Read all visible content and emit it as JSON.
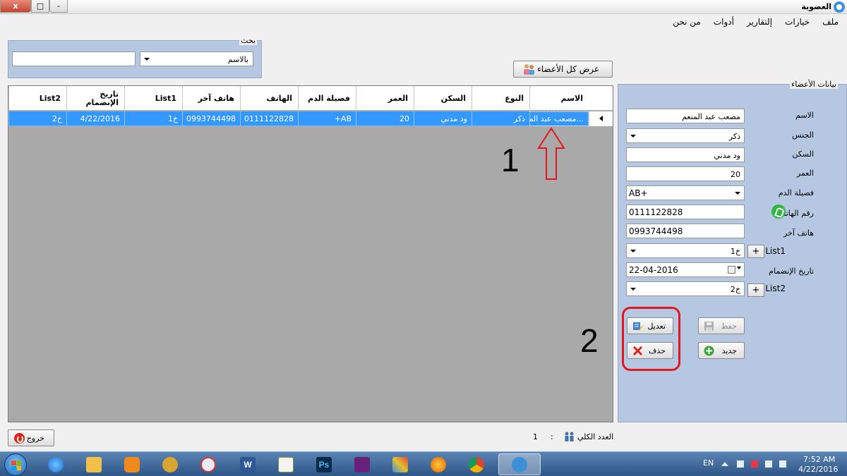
{
  "window": {
    "title": "العضوية"
  },
  "menu": [
    {
      "label": "ملف"
    },
    {
      "label": "خيارات"
    },
    {
      "label": "إلتقارير"
    },
    {
      "label": "أدوات"
    },
    {
      "label": "من نحن"
    }
  ],
  "search": {
    "legend": "بحث",
    "by_value": "بالاسم",
    "text_value": ""
  },
  "show_all_button": {
    "label": "عرض كل الأعضاء",
    "icon": "members-icon"
  },
  "grid": {
    "columns": [
      "الاسم",
      "النوع",
      "السكن",
      "العمر",
      "فصيلة الدم",
      "الهاتف",
      "هاتف آخر",
      "List1",
      "تاريخ الإنضمام",
      "List2"
    ],
    "rows": [
      [
        "مصعب عبد الم...",
        "ذكر",
        "ود مدني",
        "20",
        "+AB",
        "0111122828",
        "0993744498",
        "خ1",
        "4/22/2016",
        "خ2"
      ]
    ]
  },
  "annotations": {
    "marker_1": "1",
    "marker_2": "2",
    "highlight_color": "#e2161f"
  },
  "panel": {
    "legend": "بيانات الأعضاء",
    "fields": {
      "name": {
        "label": "الاسم",
        "value": "مصعب عبد المنعم"
      },
      "gender": {
        "label": "الجنس",
        "value": "ذكر"
      },
      "residence": {
        "label": "السكن",
        "value": "ود مدني"
      },
      "age": {
        "label": "العمر",
        "value": "20"
      },
      "blood": {
        "label": "فصيلة الدم",
        "value": "AB+"
      },
      "phone": {
        "label": "رقم الهاتف",
        "value": "0111122828"
      },
      "phone2": {
        "label": "هاتف آخر",
        "value": "0993744498"
      },
      "list1": {
        "label": "List1",
        "value": "خ1"
      },
      "join_date": {
        "label": "تاريخ الإنضمام",
        "value": "22-04-2016"
      },
      "list2": {
        "label": "List2",
        "value": "خ2"
      }
    },
    "buttons": {
      "edit": "تعديل",
      "save": "حفظ",
      "delete": "حذف",
      "new": "جديد",
      "plus": "+"
    }
  },
  "footer": {
    "exit": "خروج",
    "total_label": "العدد الكلي",
    "total_colon": ":",
    "total_count": "1"
  },
  "window_buttons": {
    "close": "x",
    "max": "□",
    "min": "-"
  },
  "taskbar": {
    "items": [
      "ie-icon",
      "explorer-icon",
      "media-player-icon",
      "app-icon",
      "snipping-tool-icon",
      "word-icon",
      "excel-icon",
      "photoshop-icon",
      "visual-studio-icon",
      "game-icon",
      "firefox-icon",
      "chrome-icon",
      "membership-app-icon"
    ],
    "word_glyph": "W",
    "photoshop_glyph": "Ps",
    "lang": "EN",
    "time": "7:52 AM",
    "date": "4/22/2016"
  }
}
